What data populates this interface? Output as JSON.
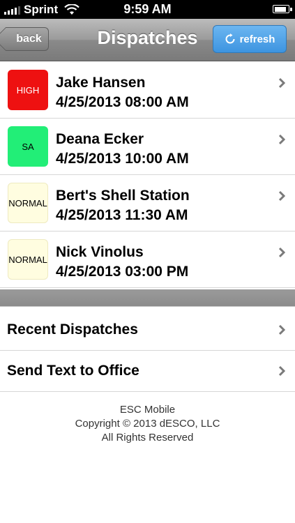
{
  "status_bar": {
    "carrier": "Sprint",
    "time": "9:59 AM",
    "battery_level": 0.9
  },
  "nav": {
    "title": "Dispatches",
    "back_label": "back",
    "refresh_label": "refresh"
  },
  "dispatches": [
    {
      "priority": "HIGH",
      "priority_color": "#ee1111",
      "name": "Jake Hansen",
      "datetime": "4/25/2013 08:00 AM"
    },
    {
      "priority": "SA",
      "priority_color": "#22ee77",
      "name": "Deana Ecker",
      "datetime": "4/25/2013 10:00 AM"
    },
    {
      "priority": "NORMAL",
      "priority_color": "#fffde0",
      "name": "Bert's Shell Station",
      "datetime": "4/25/2013 11:30 AM"
    },
    {
      "priority": "NORMAL",
      "priority_color": "#fffde0",
      "name": "Nick Vinolus",
      "datetime": "4/25/2013 03:00 PM"
    }
  ],
  "menu": {
    "items": [
      {
        "label": "Recent Dispatches"
      },
      {
        "label": "Send Text to Office"
      }
    ]
  },
  "footer": {
    "line1": "ESC Mobile",
    "line2": "Copyright © 2013 dESCO, LLC",
    "line3": "All Rights Reserved"
  }
}
